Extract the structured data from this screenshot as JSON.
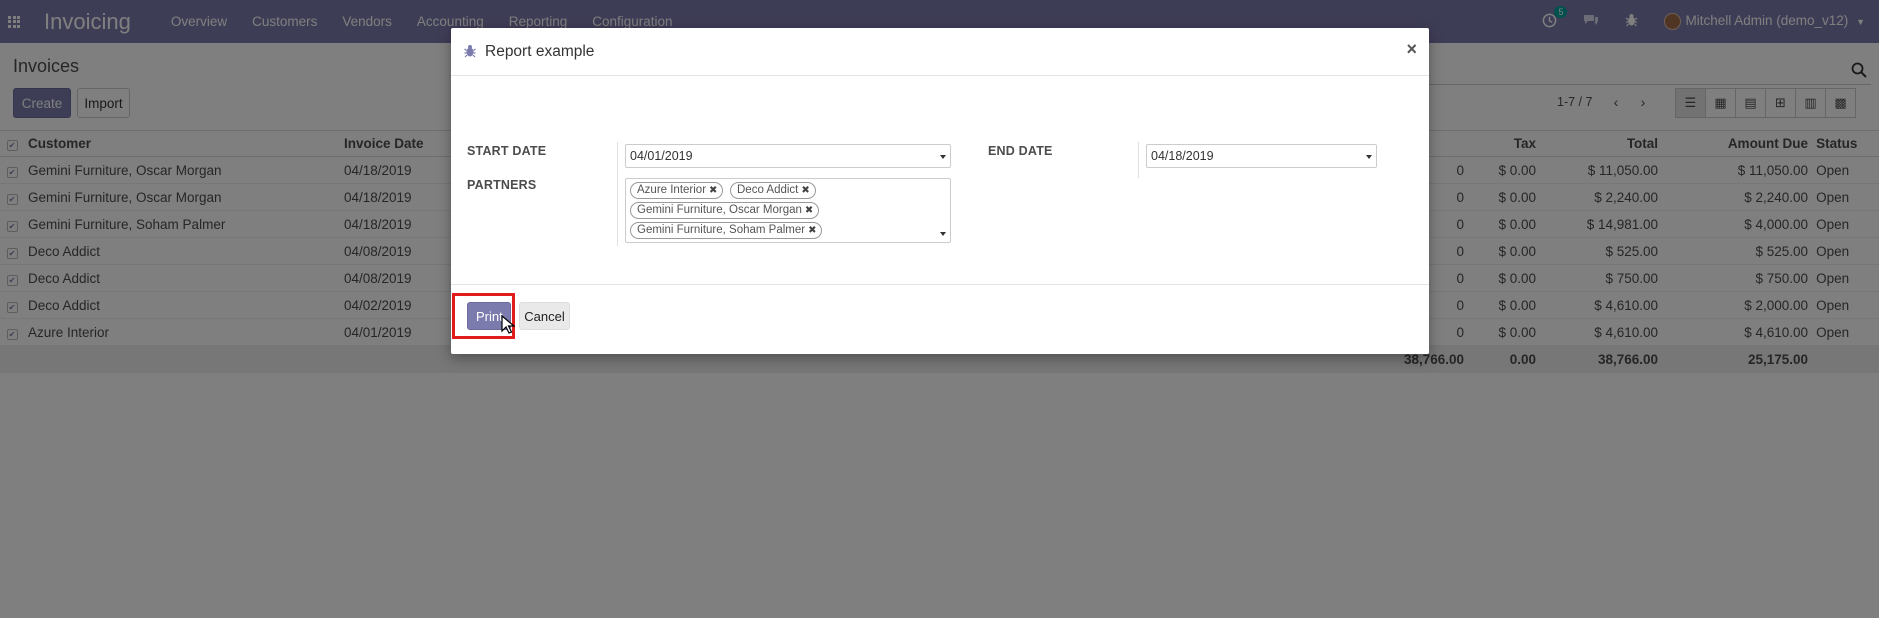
{
  "navbar": {
    "app_title": "Invoicing",
    "menu": [
      "Overview",
      "Customers",
      "Vendors",
      "Accounting",
      "Reporting",
      "Configuration"
    ],
    "activity_count": "5",
    "user_name": "Mitchell Admin (demo_v12)"
  },
  "control_panel": {
    "title": "Invoices",
    "create_label": "Create",
    "import_label": "Import",
    "pager": "1-7 / 7"
  },
  "table": {
    "headers": {
      "customer": "Customer",
      "invoice_date": "Invoice Date",
      "tax": "Tax",
      "total": "Total",
      "amount_due": "Amount Due",
      "status": "Status"
    },
    "rows": [
      {
        "customer": "Gemini Furniture, Oscar Morgan",
        "date": "04/18/2019",
        "untaxed_tail": "0",
        "tax": "$ 0.00",
        "total": "$ 11,050.00",
        "due": "$ 11,050.00",
        "status": "Open"
      },
      {
        "customer": "Gemini Furniture, Oscar Morgan",
        "date": "04/18/2019",
        "untaxed_tail": "0",
        "tax": "$ 0.00",
        "total": "$ 2,240.00",
        "due": "$ 2,240.00",
        "status": "Open"
      },
      {
        "customer": "Gemini Furniture, Soham Palmer",
        "date": "04/18/2019",
        "untaxed_tail": "0",
        "tax": "$ 0.00",
        "total": "$ 14,981.00",
        "due": "$ 4,000.00",
        "status": "Open"
      },
      {
        "customer": "Deco Addict",
        "date": "04/08/2019",
        "untaxed_tail": "0",
        "tax": "$ 0.00",
        "total": "$ 525.00",
        "due": "$ 525.00",
        "status": "Open"
      },
      {
        "customer": "Deco Addict",
        "date": "04/08/2019",
        "untaxed_tail": "0",
        "tax": "$ 0.00",
        "total": "$ 750.00",
        "due": "$ 750.00",
        "status": "Open"
      },
      {
        "customer": "Deco Addict",
        "date": "04/02/2019",
        "untaxed_tail": "0",
        "tax": "$ 0.00",
        "total": "$ 4,610.00",
        "due": "$ 2,000.00",
        "status": "Open"
      },
      {
        "customer": "Azure Interior",
        "date": "04/01/2019",
        "untaxed_tail": "0",
        "tax": "$ 0.00",
        "total": "$ 4,610.00",
        "due": "$ 4,610.00",
        "status": "Open"
      }
    ],
    "totals": {
      "untaxed": "38,766.00",
      "tax": "0.00",
      "total": "38,766.00",
      "due": "25,175.00"
    }
  },
  "modal": {
    "title": "Report example",
    "close_glyph": "×",
    "start_date_label": "START DATE",
    "start_date_value": "04/01/2019",
    "end_date_label": "END DATE",
    "end_date_value": "04/18/2019",
    "partners_label": "PARTNERS",
    "partners": [
      "Azure Interior",
      "Deco Addict",
      "Gemini Furniture, Oscar Morgan",
      "Gemini Furniture, Soham Palmer"
    ],
    "print_label": "Print",
    "cancel_label": "Cancel"
  },
  "colors": {
    "brand": "#7c7bad",
    "highlight": "#e01c1c",
    "badge": "#00a09d"
  }
}
